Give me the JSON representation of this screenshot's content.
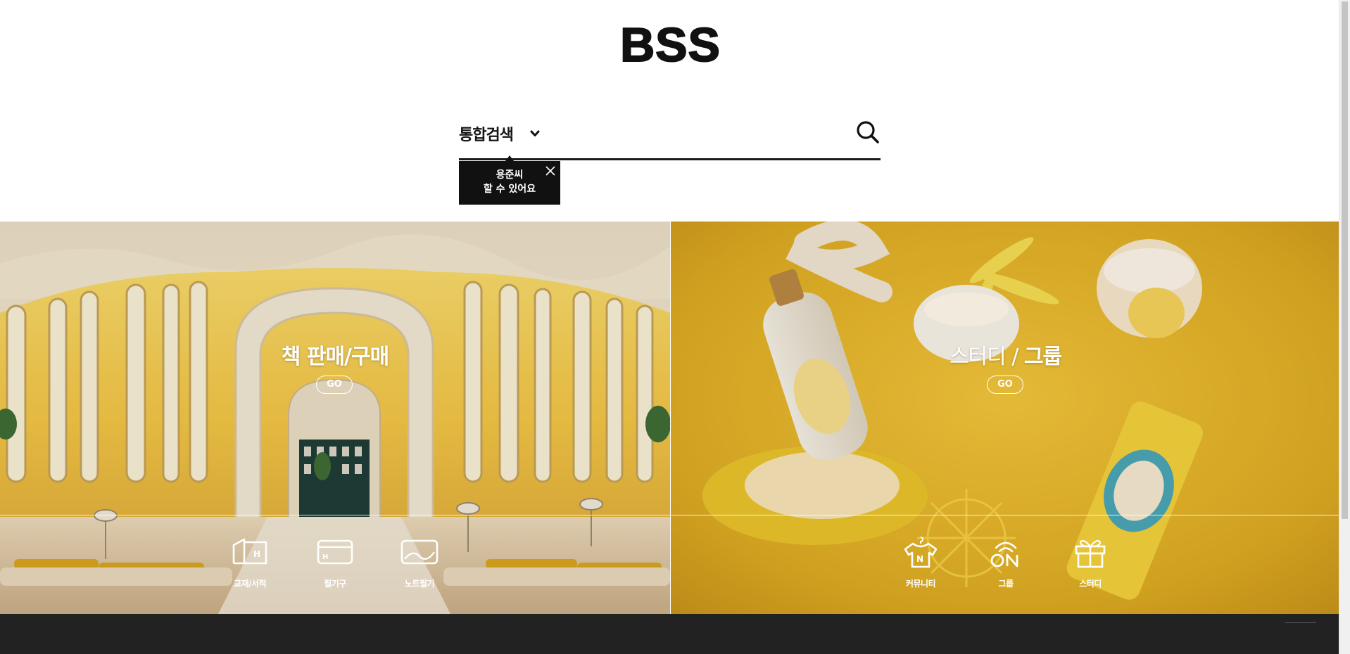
{
  "header": {
    "logo_text": "BSS"
  },
  "search": {
    "scope_label": "통합검색",
    "placeholder": ""
  },
  "tooltip": {
    "line1": "용준씨",
    "line2": "할 수 있어요"
  },
  "hero": {
    "left": {
      "title": "책 판매/구매",
      "go_label": "GO",
      "items": [
        {
          "label": "교재/서적",
          "icon": "building-icon"
        },
        {
          "label": "필기구",
          "icon": "card-icon"
        },
        {
          "label": "노트필기",
          "icon": "image-icon"
        }
      ]
    },
    "right": {
      "title_light": "스터디 / ",
      "title_bold": "그룹",
      "go_label": "GO",
      "items": [
        {
          "label": "커뮤니티",
          "icon": "shirt-icon"
        },
        {
          "label": "그룹",
          "icon": "on-icon"
        },
        {
          "label": "스터디",
          "icon": "gift-icon"
        }
      ]
    }
  },
  "colors": {
    "accent_dark": "#111111",
    "footer": "#222222",
    "hero_yellow": "#e0b31e"
  }
}
